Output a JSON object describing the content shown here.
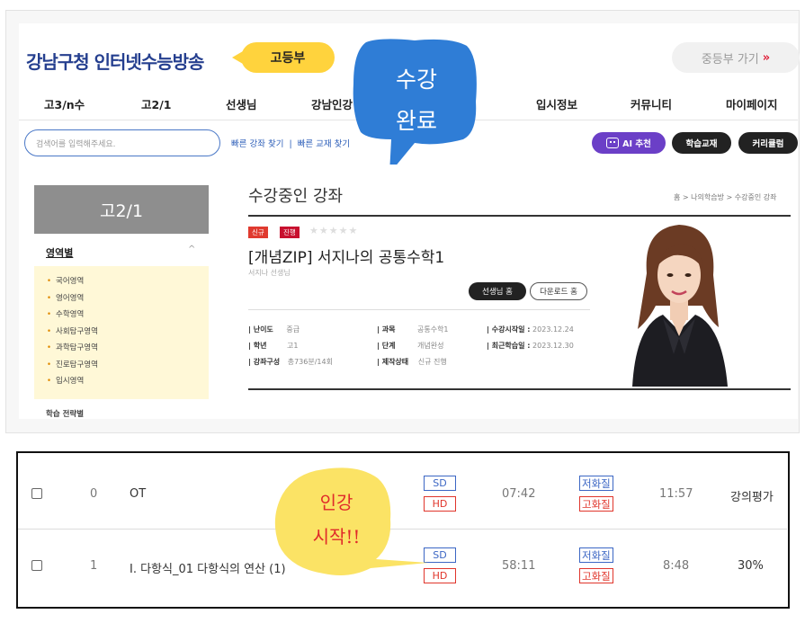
{
  "header": {
    "logo": "강남구청 인터넷수능방송",
    "grade": "고등부",
    "switch_label": "중등부 가기",
    "switch_arrow": "»"
  },
  "nav": [
    "고3/n수",
    "고2/1",
    "선생님",
    "강남인강",
    "입시정보",
    "커뮤니티",
    "마이페이지"
  ],
  "search": {
    "placeholder": "검색어를 입력해주세요.",
    "quick_lecture": "빠른 강좌 찾기",
    "quick_sep": "|",
    "quick_book": "빠른 교재 찾기"
  },
  "buttons": {
    "ai": "AI 추천",
    "textbook": "학습교재",
    "curriculum": "커리큘럼"
  },
  "sidebar": {
    "title": "고2/1",
    "category": "영역별",
    "caret": "^",
    "items": [
      "국어영역",
      "영어영역",
      "수학영역",
      "사회탐구영역",
      "과학탐구영역",
      "진로탐구영역",
      "입시영역"
    ],
    "more": "학습 전략별"
  },
  "content": {
    "page_title": "수강중인 강좌",
    "breadcrumb": "홈 > 나의학습방 > 수강중인 강좌",
    "badges": [
      "신규",
      "진행"
    ],
    "stars": "★★★★★",
    "course_title": "[개념ZIP] 서지나의 공통수학1",
    "teacher": "서지나 선생님",
    "btn_teacher_home": "선생님 홈",
    "btn_download_home": "다운로드 홈",
    "info": {
      "difficulty_k": "| 난이도",
      "difficulty_v": "중급",
      "subject_k": "| 과목",
      "subject_v": "공통수학1",
      "start_k": "| 수강시작일 :",
      "start_v": "2023.12.24",
      "grade_k": "| 학년",
      "grade_v": "고1",
      "stage_k": "| 단계",
      "stage_v": "개념완성",
      "recent_k": "| 최근학습일 :",
      "recent_v": "2023.12.30",
      "compose_k": "| 강좌구성",
      "compose_v": "총736분/14회",
      "status_k": "| 제작상태",
      "status_v": "신규 진행"
    }
  },
  "lectures": [
    {
      "no": "0",
      "title": "OT",
      "sd": "SD",
      "hd": "HD",
      "time": "07:42",
      "low": "저화질",
      "high": "고화질",
      "watched": "11:57",
      "rating": "강의평가"
    },
    {
      "no": "1",
      "title": "I. 다항식_01 다항식의 연산 (1)",
      "sd": "SD",
      "hd": "HD",
      "time": "58:11",
      "low": "저화질",
      "high": "고화질",
      "watched": "8:48",
      "rating": "30%"
    }
  ],
  "bubbles": {
    "blue_line1": "수강",
    "blue_line2": "완료",
    "yellow_line1": "인강",
    "yellow_line2": "시작!!"
  },
  "colors": {
    "logo": "#253f8f",
    "grade_pill": "#ffd33d",
    "ai_button": "#6b3fc7",
    "blue_bubble": "#2f7dd6",
    "yellow_bubble": "#fbe365",
    "badge_new": "#e03a2f",
    "badge_progress": "#c8102e"
  }
}
